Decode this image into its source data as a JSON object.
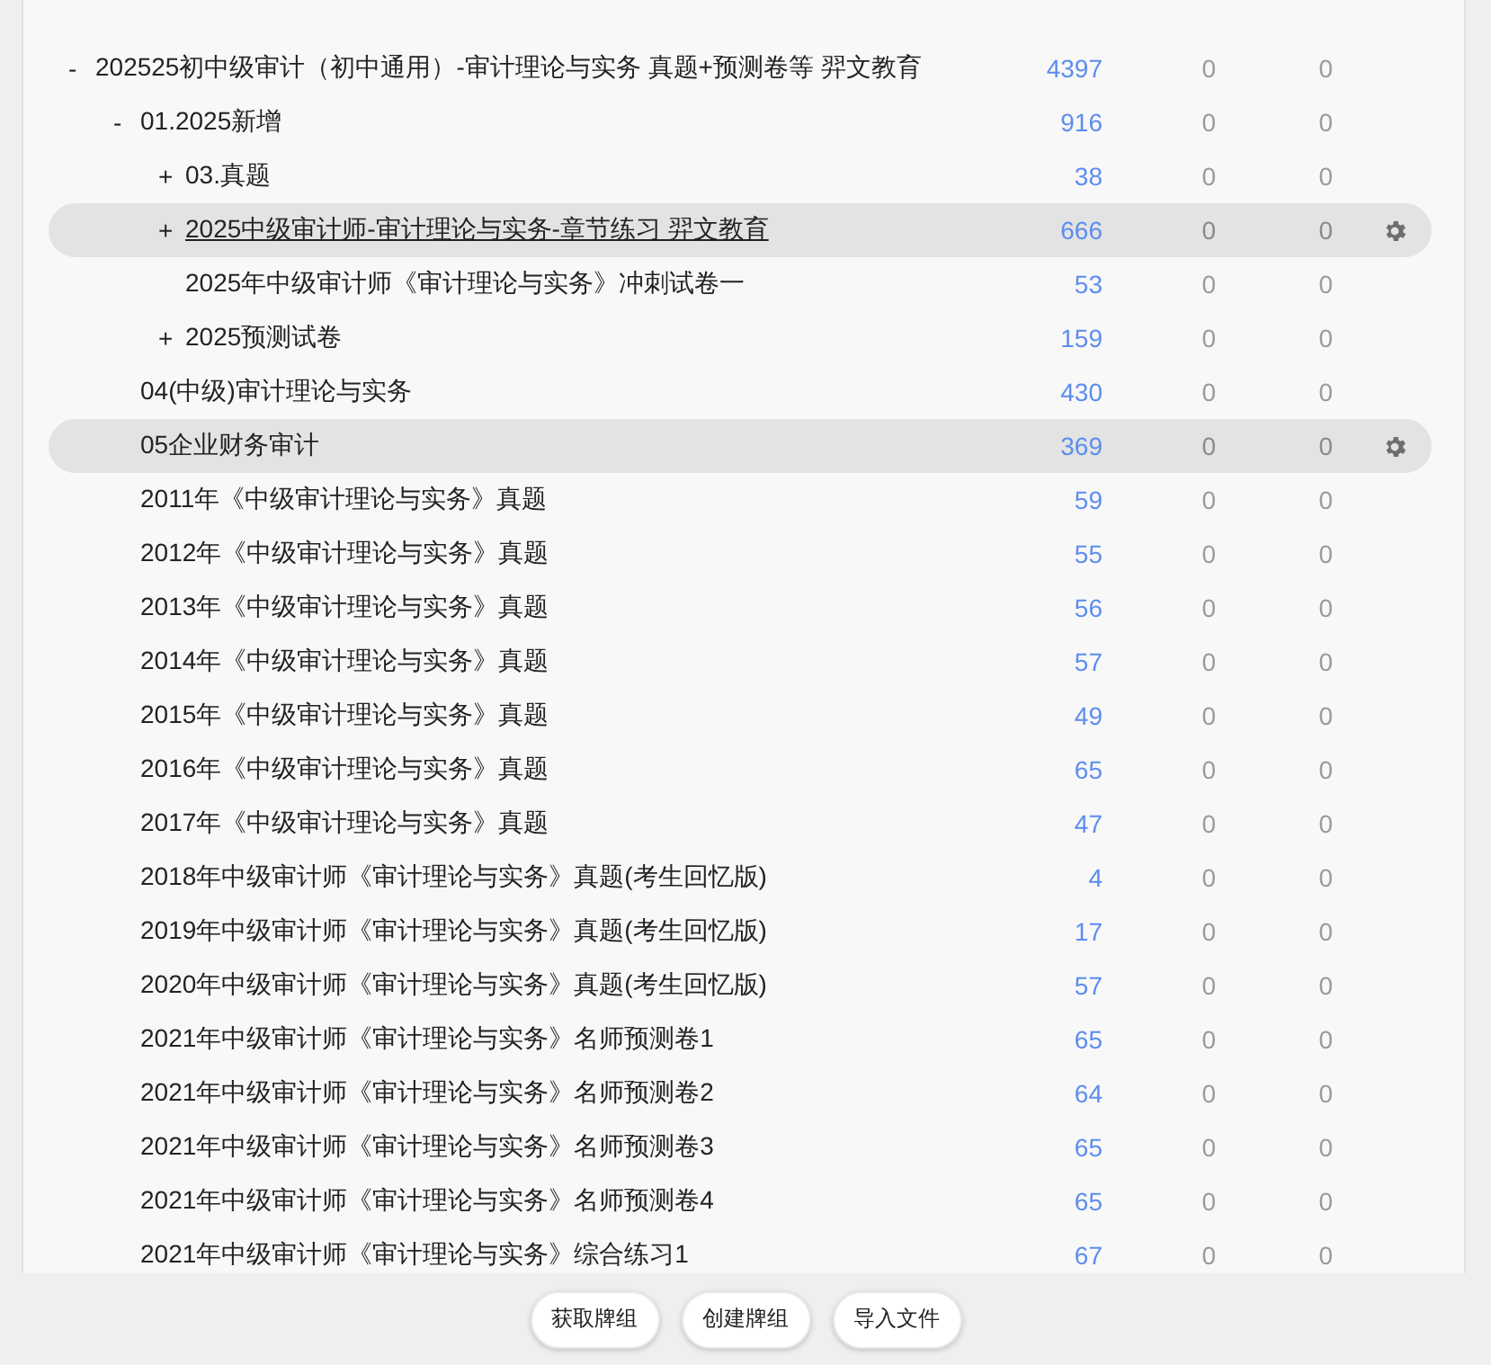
{
  "decks": [
    {
      "name": "202525初中级审计（初中通用）-审计理论与实务 真题+预测卷等 羿文教育",
      "expanded": true,
      "current": false,
      "highlighted": false,
      "new": "4397",
      "learn": "0",
      "review": "0",
      "children": [
        {
          "name": "01.2025新增",
          "expanded": true,
          "current": false,
          "highlighted": false,
          "new": "916",
          "learn": "0",
          "review": "0",
          "children": [
            {
              "name": "03.真题",
              "expanded": false,
              "current": false,
              "highlighted": false,
              "new": "38",
              "learn": "0",
              "review": "0"
            },
            {
              "name": "2025中级审计师-审计理论与实务-章节练习 羿文教育",
              "expanded": false,
              "current": true,
              "highlighted": true,
              "new": "666",
              "learn": "0",
              "review": "0"
            },
            {
              "name": "2025年中级审计师《审计理论与实务》冲刺试卷一",
              "current": false,
              "highlighted": false,
              "new": "53",
              "learn": "0",
              "review": "0"
            },
            {
              "name": "2025预测试卷",
              "expanded": false,
              "current": false,
              "highlighted": false,
              "new": "159",
              "learn": "0",
              "review": "0"
            }
          ]
        },
        {
          "name": "04(中级)审计理论与实务",
          "current": false,
          "highlighted": false,
          "new": "430",
          "learn": "0",
          "review": "0"
        },
        {
          "name": "05企业财务审计",
          "current": false,
          "highlighted": true,
          "new": "369",
          "learn": "0",
          "review": "0"
        },
        {
          "name": "2011年《中级审计理论与实务》真题",
          "current": false,
          "highlighted": false,
          "new": "59",
          "learn": "0",
          "review": "0"
        },
        {
          "name": "2012年《中级审计理论与实务》真题",
          "current": false,
          "highlighted": false,
          "new": "55",
          "learn": "0",
          "review": "0"
        },
        {
          "name": "2013年《中级审计理论与实务》真题",
          "current": false,
          "highlighted": false,
          "new": "56",
          "learn": "0",
          "review": "0"
        },
        {
          "name": "2014年《中级审计理论与实务》真题",
          "current": false,
          "highlighted": false,
          "new": "57",
          "learn": "0",
          "review": "0"
        },
        {
          "name": "2015年《中级审计理论与实务》真题",
          "current": false,
          "highlighted": false,
          "new": "49",
          "learn": "0",
          "review": "0"
        },
        {
          "name": "2016年《中级审计理论与实务》真题",
          "current": false,
          "highlighted": false,
          "new": "65",
          "learn": "0",
          "review": "0"
        },
        {
          "name": "2017年《中级审计理论与实务》真题",
          "current": false,
          "highlighted": false,
          "new": "47",
          "learn": "0",
          "review": "0"
        },
        {
          "name": "2018年中级审计师《审计理论与实务》真题(考生回忆版)",
          "current": false,
          "highlighted": false,
          "new": "4",
          "learn": "0",
          "review": "0"
        },
        {
          "name": "2019年中级审计师《审计理论与实务》真题(考生回忆版)",
          "current": false,
          "highlighted": false,
          "new": "17",
          "learn": "0",
          "review": "0"
        },
        {
          "name": "2020年中级审计师《审计理论与实务》真题(考生回忆版)",
          "current": false,
          "highlighted": false,
          "new": "57",
          "learn": "0",
          "review": "0"
        },
        {
          "name": "2021年中级审计师《审计理论与实务》名师预测卷1",
          "current": false,
          "highlighted": false,
          "new": "65",
          "learn": "0",
          "review": "0"
        },
        {
          "name": "2021年中级审计师《审计理论与实务》名师预测卷2",
          "current": false,
          "highlighted": false,
          "new": "64",
          "learn": "0",
          "review": "0"
        },
        {
          "name": "2021年中级审计师《审计理论与实务》名师预测卷3",
          "current": false,
          "highlighted": false,
          "new": "65",
          "learn": "0",
          "review": "0"
        },
        {
          "name": "2021年中级审计师《审计理论与实务》名师预测卷4",
          "current": false,
          "highlighted": false,
          "new": "65",
          "learn": "0",
          "review": "0"
        },
        {
          "name": "2021年中级审计师《审计理论与实务》综合练习1",
          "current": false,
          "highlighted": false,
          "new": "67",
          "learn": "0",
          "review": "0"
        }
      ]
    }
  ],
  "toggle_symbols": {
    "expanded": "-",
    "collapsed": "+"
  },
  "buttons": [
    "获取牌组",
    "创建牌组",
    "导入文件"
  ]
}
